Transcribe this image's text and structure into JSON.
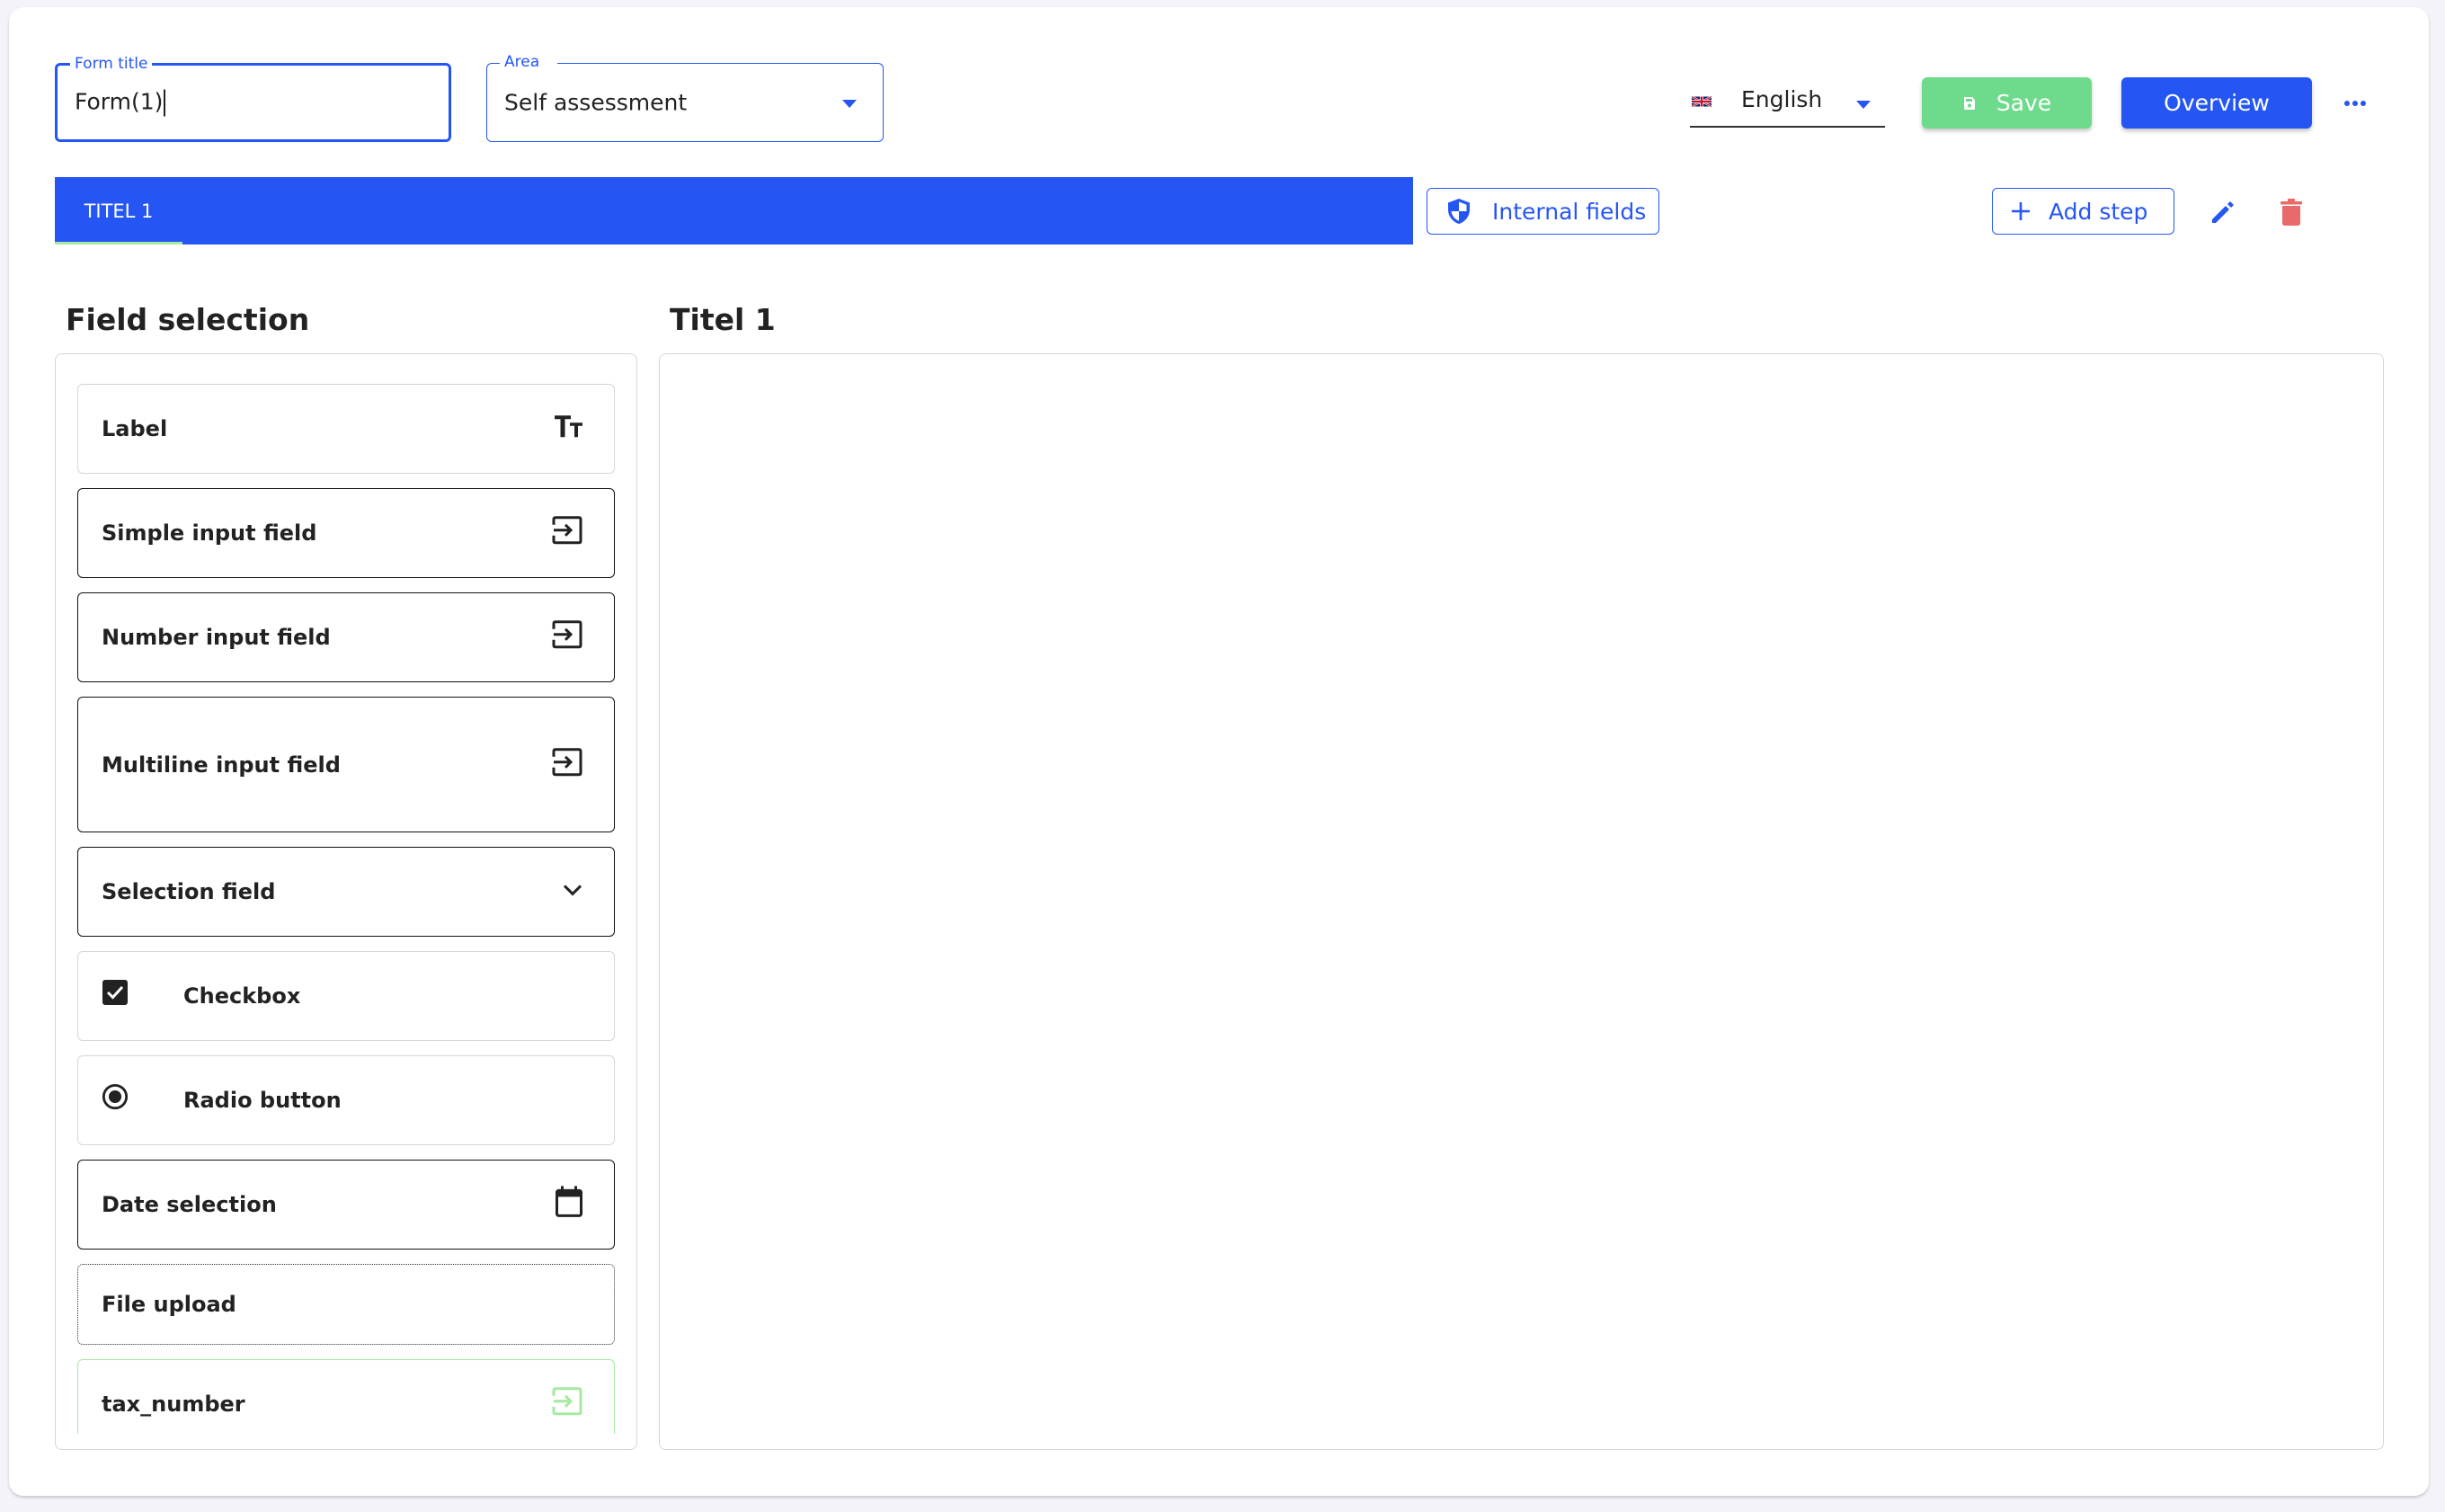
{
  "header": {
    "form_title": {
      "label": "Form title",
      "value": "Form(1)"
    },
    "area": {
      "label": "Area",
      "value": "Self assessment"
    },
    "language": {
      "value": "English",
      "flag": "uk-flag-icon"
    },
    "save_label": "Save",
    "overview_label": "Overview",
    "more_icon": "more-horizontal-icon"
  },
  "steps": {
    "tabs": [
      {
        "label": "TITEL 1",
        "active": true
      }
    ],
    "internal_fields_label": "Internal fields",
    "add_step_label": "Add step",
    "edit_icon": "pencil-icon",
    "delete_icon": "trash-icon"
  },
  "field_selection": {
    "title": "Field selection",
    "items": [
      {
        "label": "Label",
        "icon": "text-size-icon"
      },
      {
        "label": "Simple input field",
        "icon": "input-icon"
      },
      {
        "label": "Number input field",
        "icon": "input-icon"
      },
      {
        "label": "Multiline input field",
        "icon": "input-icon"
      },
      {
        "label": "Selection field",
        "icon": "chevron-down-icon"
      },
      {
        "label": "Checkbox",
        "icon": "checkbox-checked-icon"
      },
      {
        "label": "Radio button",
        "icon": "radio-checked-icon"
      },
      {
        "label": "Date selection",
        "icon": "calendar-icon"
      },
      {
        "label": "File upload",
        "icon": ""
      },
      {
        "label": "tax_number",
        "icon": "input-icon"
      }
    ]
  },
  "canvas": {
    "title": "Titel 1"
  },
  "colors": {
    "primary": "#2556f4",
    "success": "#6ddb8b",
    "danger": "#e86a6a",
    "tab_indicator": "#a6e9a0"
  }
}
